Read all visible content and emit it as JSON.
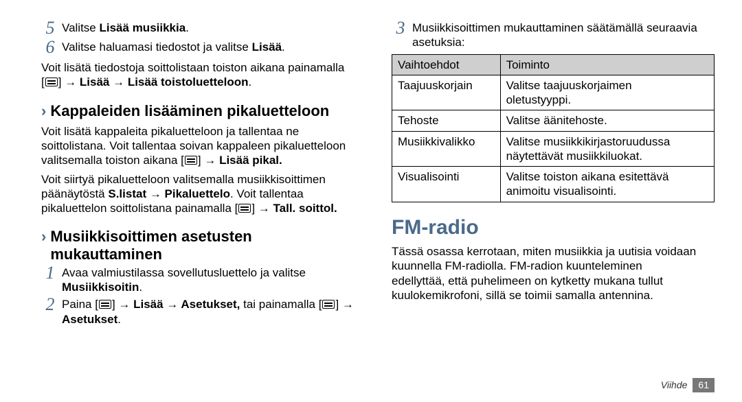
{
  "left": {
    "step5": {
      "pre": "Valitse ",
      "bold": "Lisää musiikkia",
      "post": "."
    },
    "step6": {
      "pre": "Valitse haluamasi tiedostot ja valitse ",
      "bold": "Lisää",
      "post": "."
    },
    "insertNote": {
      "line1": "Voit lisätä tiedostoja soittolistaan toiston aikana painamalla",
      "line2_pre": "[",
      "line2_post": "] ",
      "line2_bold": "→ Lisää → Lisää toistoluetteloon",
      "line2_end": "."
    },
    "sub1": "Kappaleiden lisääminen pikaluetteloon",
    "sub1_para1": {
      "l1": "Voit lisätä kappaleita pikaluetteloon ja tallentaa ne",
      "l2": "soittolistana. Voit tallentaa soivan kappaleen pikaluetteloon",
      "l3_pre": "valitsemalla toiston aikana [",
      "l3_post": "] ",
      "l3_bold": "→ Lisää pikal."
    },
    "sub1_para2": {
      "l1": "Voit siirtyä pikaluetteloon valitsemalla musiikkisoittimen",
      "l2_pre": "päänäytöstä ",
      "l2_bold": "S.listat → Pikaluettelo",
      "l2_post": ". Voit tallentaa",
      "l3_pre": "pikaluettelon soittolistana painamalla [",
      "l3_post": "] ",
      "l3_bold": "→ Tall. soittol."
    },
    "sub2": "Musiikkisoittimen asetusten mukauttaminen",
    "step1": {
      "l1": "Avaa valmiustilassa sovellutusluettelo ja valitse",
      "bold": "Musiikkisoitin",
      "post": "."
    },
    "step2": {
      "pre": "Paina [",
      "mid1": "] ",
      "bold1": "→ Lisää → Asetukset,",
      "mid2": " tai painamalla [",
      "post": "] →",
      "bold2": "Asetukset",
      "end": "."
    }
  },
  "right": {
    "step3": {
      "l1": "Musiikkisoittimen mukauttaminen säätämällä seuraavia",
      "l2": "asetuksia:"
    },
    "table": {
      "h1": "Vaihtoehdot",
      "h2": "Toiminto",
      "rows": [
        {
          "c1": "Taajuuskorjain",
          "c2a": "Valitse taajuuskorjaimen",
          "c2b": "oletustyyppi."
        },
        {
          "c1": "Tehoste",
          "c2a": "Valitse äänitehoste.",
          "c2b": ""
        },
        {
          "c1": "Musiikkivalikko",
          "c2a": "Valitse musiikkikirjastoruudussa",
          "c2b": "näytettävät musiikkiluokat."
        },
        {
          "c1": "Visualisointi",
          "c2a": "Valitse toiston aikana esitettävä",
          "c2b": "animoitu visualisointi."
        }
      ]
    },
    "fm_title": "FM-radio",
    "fm_para": {
      "l1": "Tässä osassa kerrotaan, miten musiikkia ja uutisia voidaan",
      "l2": "kuunnella FM-radiolla. FM-radion kuunteleminen",
      "l3": "edellyttää, että puhelimeen on kytketty mukana tullut",
      "l4": "kuulokemikrofoni, sillä se toimii samalla antennina."
    }
  },
  "footer": {
    "section": "Viihde",
    "page": "61"
  }
}
